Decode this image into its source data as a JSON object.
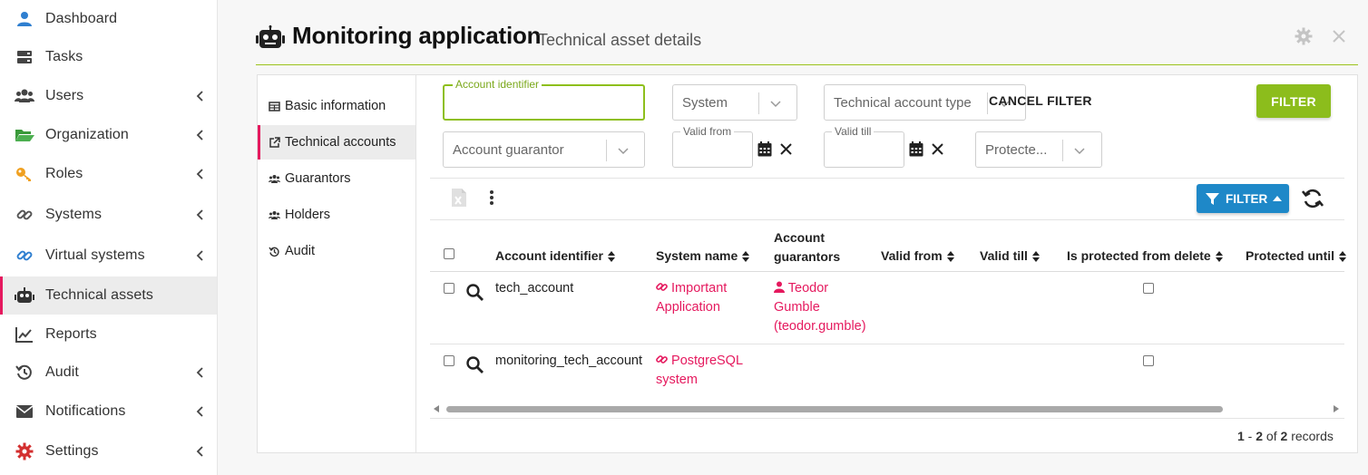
{
  "sidebar": {
    "items": [
      {
        "label": "Dashboard",
        "icon": "user-icon",
        "chevron": false
      },
      {
        "label": "Tasks",
        "icon": "server-icon",
        "chevron": false
      },
      {
        "label": "Users",
        "icon": "users-icon",
        "chevron": true
      },
      {
        "label": "Organization",
        "icon": "folder-open-icon",
        "chevron": true
      },
      {
        "label": "Roles",
        "icon": "key-icon",
        "chevron": true
      },
      {
        "label": "Systems",
        "icon": "link-icon",
        "chevron": true
      },
      {
        "label": "Virtual systems",
        "icon": "link-icon",
        "chevron": true
      },
      {
        "label": "Technical assets",
        "icon": "robot-icon",
        "chevron": false,
        "active": true
      },
      {
        "label": "Reports",
        "icon": "line-chart-icon",
        "chevron": false
      },
      {
        "label": "Audit",
        "icon": "history-icon",
        "chevron": true
      },
      {
        "label": "Notifications",
        "icon": "envelope-icon",
        "chevron": true
      },
      {
        "label": "Settings",
        "icon": "gear-icon",
        "chevron": true
      }
    ]
  },
  "header": {
    "title": "Monitoring application",
    "subtitle": "Technical asset details"
  },
  "tabs": [
    {
      "label": "Basic information",
      "icon": "table-icon"
    },
    {
      "label": "Technical accounts",
      "icon": "external-link-icon",
      "active": true
    },
    {
      "label": "Guarantors",
      "icon": "users-icon"
    },
    {
      "label": "Holders",
      "icon": "users-icon"
    },
    {
      "label": "Audit",
      "icon": "history-icon"
    }
  ],
  "filters": {
    "account_identifier": {
      "label": "Account identifier",
      "value": ""
    },
    "system": {
      "placeholder": "System"
    },
    "technical_account_type": {
      "placeholder": "Technical account type"
    },
    "account_guarantor": {
      "placeholder": "Account guarantor"
    },
    "valid_from": {
      "label": "Valid from",
      "value": ""
    },
    "valid_till": {
      "label": "Valid till",
      "value": ""
    },
    "protected": {
      "placeholder": "Protecte..."
    },
    "cancel_label": "CANCEL FILTER",
    "filter_label": "FILTER"
  },
  "toolbar": {
    "filter_toggle_label": "FILTER"
  },
  "table": {
    "columns": [
      {
        "label": "Account identifier"
      },
      {
        "label": "System name"
      },
      {
        "label": "Account",
        "label2": "guarantors"
      },
      {
        "label": "Valid from"
      },
      {
        "label": "Valid till"
      },
      {
        "label": "Is protected from delete"
      },
      {
        "label": "Protected until"
      }
    ],
    "rows": [
      {
        "account_identifier": "tech_account",
        "system_line1": "Important",
        "system_line2": "Application",
        "guarantor_line1": "Teodor",
        "guarantor_line2": "Gumble",
        "guarantor_line3": "(teodor.gumble)"
      },
      {
        "account_identifier": "monitoring_tech_account",
        "system_line1": "PostgreSQL",
        "system_line2": "system",
        "guarantor_line1": "",
        "guarantor_line2": "",
        "guarantor_line3": ""
      }
    ]
  },
  "pagination": {
    "start": "1",
    "dash": " - ",
    "end": "2",
    "of": " of ",
    "total": "2",
    "suffix": " records"
  },
  "colors": {
    "accent_pink": "#e5195e",
    "accent_green": "#8cbd1c",
    "accent_blue": "#1e88c8"
  }
}
